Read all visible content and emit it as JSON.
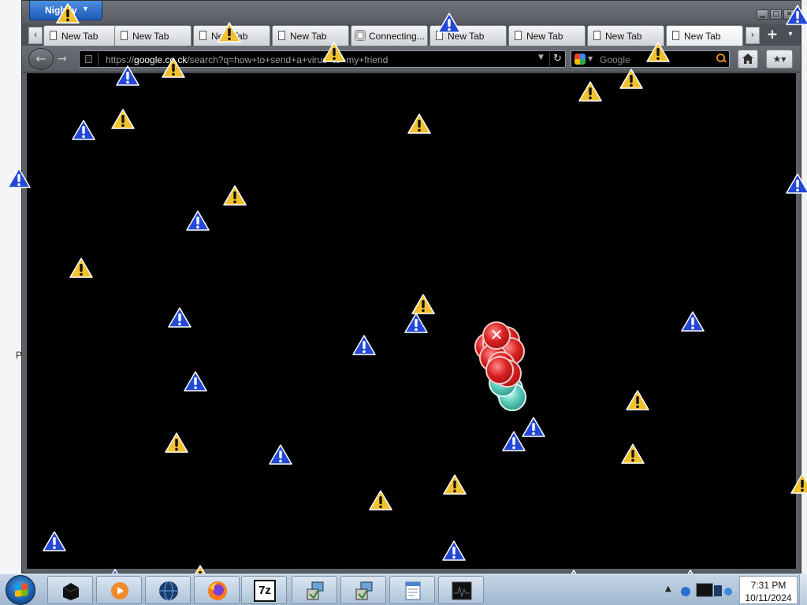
{
  "app_menu": {
    "label": "Nightly"
  },
  "window_controls": {
    "minimize": "▁",
    "maximize": "▢",
    "close": "✕"
  },
  "tabs": [
    {
      "label": "New Tab",
      "icon": "page-icon"
    },
    {
      "label": "New Tab",
      "icon": "page-icon"
    },
    {
      "label": "New Tab",
      "icon": "page-icon"
    },
    {
      "label": "New Tab",
      "icon": "page-icon"
    },
    {
      "label": "Connecting...",
      "icon": "loading-icon"
    },
    {
      "label": "New Tab",
      "icon": "page-icon"
    },
    {
      "label": "New Tab",
      "icon": "page-icon"
    },
    {
      "label": "New Tab",
      "icon": "page-icon"
    },
    {
      "label": "New Tab",
      "icon": "page-icon"
    }
  ],
  "active_tab_index": 8,
  "url": {
    "scheme": "https://",
    "domain": "google.co.ck",
    "path": "/search?q=how+to+send+a+virus+to+my+friend"
  },
  "search": {
    "placeholder": "Google"
  },
  "desktop_fragment": "P",
  "warning_colors": {
    "yellow": "#f2c12e",
    "blue": "#2347d6"
  },
  "taskbar": {
    "apps": [
      {
        "name": "black-box-app-icon"
      },
      {
        "name": "media-player-icon"
      },
      {
        "name": "globe-browser-icon"
      },
      {
        "name": "firefox-icon"
      },
      {
        "name": "7zip-icon",
        "label": "7z"
      },
      {
        "name": "installer-icon"
      },
      {
        "name": "installer-icon"
      },
      {
        "name": "wordpad-icon"
      },
      {
        "name": "monitor-app-icon"
      }
    ],
    "clock": {
      "time": "7:31 PM",
      "date": "10/11/2024"
    }
  }
}
